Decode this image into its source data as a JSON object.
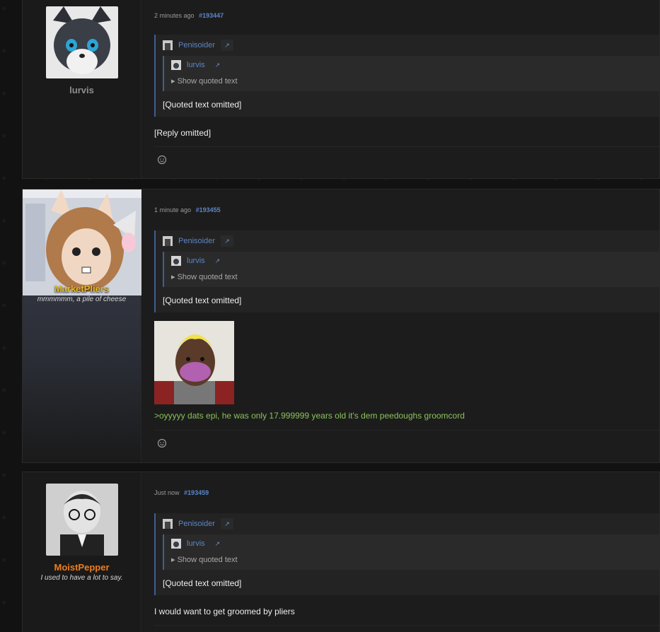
{
  "posts": [
    {
      "username": "lurvis",
      "user_title": "",
      "name_color": "#8e8e8e",
      "time": "2 minutes ago",
      "post_id": "#193447",
      "quote_author": "Penisoider",
      "nested_author": "lurvis",
      "show_quoted": "▸ Show quoted text",
      "quote_text": "[Quoted text omitted]",
      "reply": "[Reply omitted]",
      "reply_green": false
    },
    {
      "username": "MarketPliers",
      "user_title": "mmmmmm, a pile of cheese",
      "name_color": "#e6b824",
      "time": "1 minute ago",
      "post_id": "#193455",
      "quote_author": "Penisoider",
      "nested_author": "lurvis",
      "show_quoted": "▸ Show quoted text",
      "quote_text": "[Quoted text omitted]",
      "reply": ">oyyyyy dats epi, he was only 17.999999 years old it's dem peedoughs groomcord",
      "reply_green": true
    },
    {
      "username": "MoistPepper",
      "user_title": "I used to have a lot to say.",
      "name_color": "#f07d1c",
      "time": "Just now",
      "post_id": "#193459",
      "quote_author": "Penisoider",
      "nested_author": "lurvis",
      "show_quoted": "▸ Show quoted text",
      "quote_text": "[Quoted text omitted]",
      "reply": "I would want to get groomed by pliers",
      "reply_green": false
    }
  ],
  "icons": {
    "react": "smiley-face-icon",
    "jump": "jump-arrow-icon"
  }
}
